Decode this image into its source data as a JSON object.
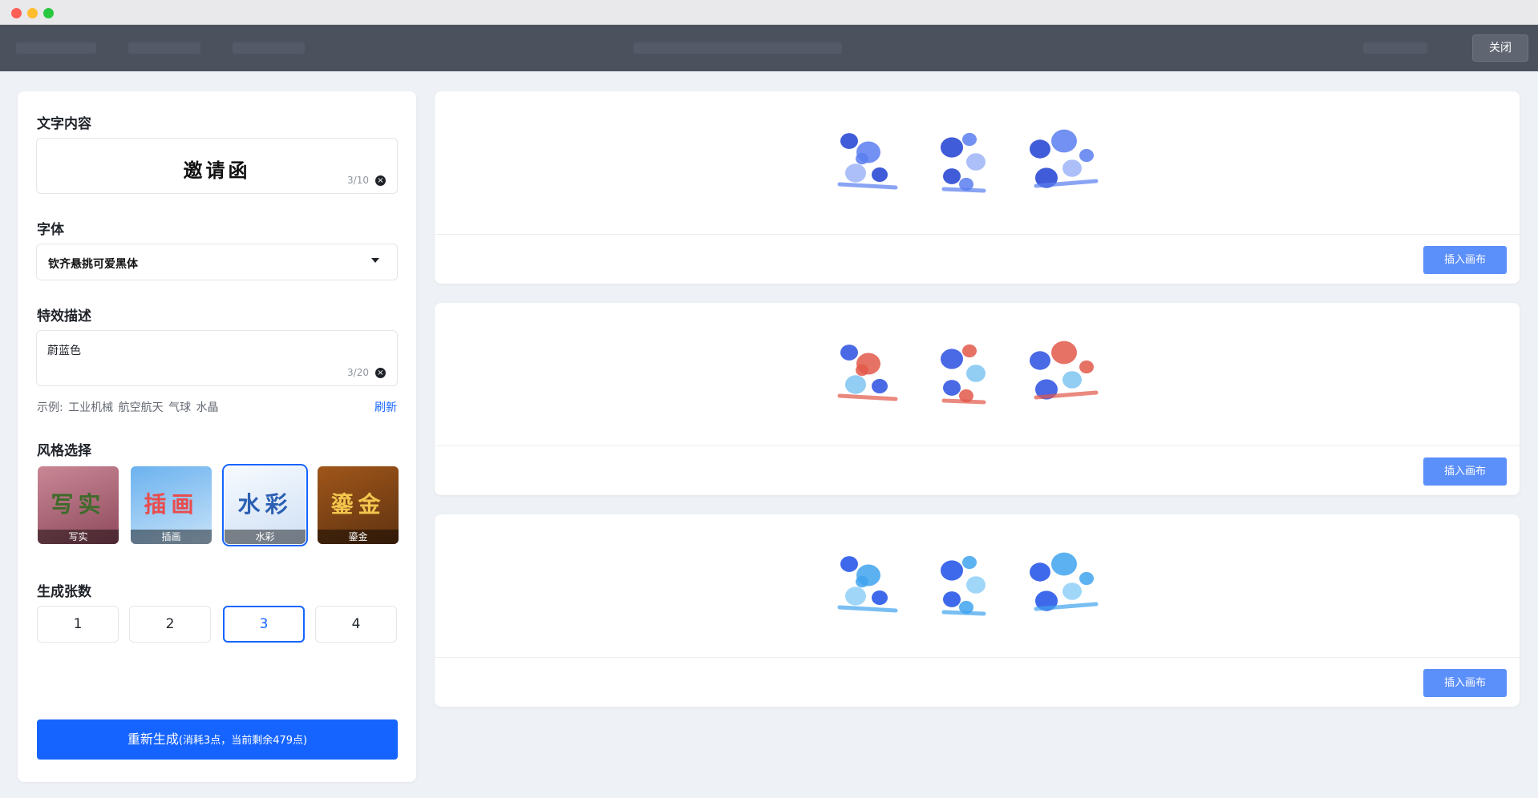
{
  "window": {
    "controls": [
      "close",
      "minimize",
      "maximize"
    ]
  },
  "toolbar": {
    "close_label": "关闭"
  },
  "form": {
    "text_section": {
      "label": "文字内容",
      "value": "邀请函",
      "counter": "3/10"
    },
    "font_section": {
      "label": "字体",
      "selected": "钦齐悬挑可爱黑体"
    },
    "effect_section": {
      "label": "特效描述",
      "value": "蔚蓝色",
      "counter": "3/20"
    },
    "examples": {
      "prefix": "示例:",
      "items": [
        "工业机械",
        "航空航天",
        "气球",
        "水晶"
      ],
      "refresh_label": "刷新"
    },
    "style_section": {
      "label": "风格选择",
      "options": [
        {
          "name": "写实",
          "glyphs": "写实",
          "selected": false,
          "bg": "#b56a7a",
          "fg": "#3e6b2a"
        },
        {
          "name": "插画",
          "glyphs": "插画",
          "selected": false,
          "bg": "#8fc3ef",
          "fg": "#e94c4c"
        },
        {
          "name": "水彩",
          "glyphs": "水彩",
          "selected": true,
          "bg": "#eaf2fb",
          "fg": "#2b5fb3"
        },
        {
          "name": "鎏金",
          "glyphs": "鎏金",
          "selected": false,
          "bg": "#8a4d16",
          "fg": "#f3c64e"
        }
      ]
    },
    "count_section": {
      "label": "生成张数",
      "options": [
        "1",
        "2",
        "3",
        "4"
      ],
      "selected": "3"
    },
    "generate": {
      "label": "重新生成",
      "sub": "(消耗3点，当前剩余479点)"
    }
  },
  "results": [
    {
      "insert_label": "插入画布",
      "palette": [
        "#1e3fd1",
        "#5a7ef0",
        "#9db4f7"
      ]
    },
    {
      "insert_label": "插入画布",
      "palette": [
        "#2a4fe0",
        "#e2584a",
        "#7fc4f2"
      ]
    },
    {
      "insert_label": "插入画布",
      "palette": [
        "#1d4fe8",
        "#3fa3ee",
        "#8fd0f7"
      ]
    }
  ],
  "colors": {
    "accent": "#1664ff",
    "insert_button": "#5b8ff9",
    "toolbar": "#4b515d"
  }
}
